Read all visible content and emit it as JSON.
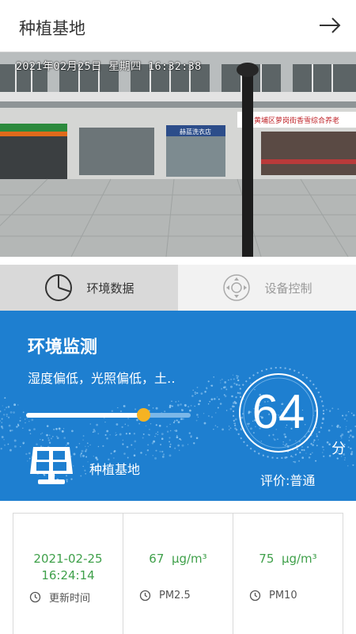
{
  "header": {
    "title": "种植基地"
  },
  "camera": {
    "timestamp": "2021年02月25日 星期四 16:32:38",
    "shop_sign": "赫蓝洗衣店",
    "street_sign": "黄埔区萝岗街香雪综合养老"
  },
  "tabs": [
    {
      "label": "环境数据",
      "active": true,
      "icon": "pie-chart-icon"
    },
    {
      "label": "设备控制",
      "active": false,
      "icon": "direction-pad-icon"
    }
  ],
  "panel": {
    "title": "环境监测",
    "summary": "湿度偏低，光照偏低，土‥",
    "slider_level": 0.71,
    "base_name": "种植基地",
    "score": "64",
    "score_unit": "分",
    "evaluation": "评价:普通"
  },
  "metrics": [
    {
      "value_line1": "2021-02-25",
      "value_line2": "16:24:14",
      "unit": "",
      "label": "更新时间",
      "icon": "clock-icon"
    },
    {
      "value_line1": "67",
      "value_line2": "",
      "unit": "μg/m³",
      "label": "PM2.5",
      "icon": "clock-icon"
    },
    {
      "value_line1": "75",
      "value_line2": "",
      "unit": "μg/m³",
      "label": "PM10",
      "icon": "clock-icon"
    }
  ],
  "colors": {
    "accent_blue": "#1e7fd0",
    "value_green": "#3fa04a",
    "slider_thumb": "#f5b323"
  }
}
